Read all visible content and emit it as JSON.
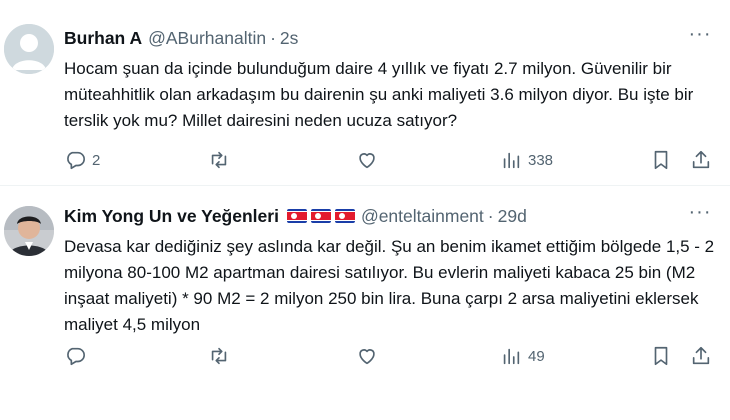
{
  "tweets": [
    {
      "display_name": "Burhan A",
      "handle": "@ABurhanaltin",
      "separator": "·",
      "time": "2s",
      "text": "Hocam şuan da içinde bulunduğum daire 4 yıllık ve fiyatı 2.7 milyon. Güvenilir bir müteahhitlik olan arkadaşım bu dairenin şu anki maliyeti 3.6 milyon diyor. Bu işte bir terslik yok mu? Millet dairesini neden ucuza satıyor?",
      "more_icon": "···",
      "replies": "2",
      "retweets": "",
      "likes": "",
      "views": "338",
      "avatar": "default-avatar"
    },
    {
      "display_name": "Kim Yong Un ve Yeğenleri",
      "flags": [
        "north-korea-flag",
        "north-korea-flag",
        "north-korea-flag"
      ],
      "handle": "@enteltainment",
      "separator": "·",
      "time": "29d",
      "text": "Devasa kar dediğiniz şey aslında kar değil. Şu an benim ikamet ettiğim bölgede 1,5 - 2 milyona 80-100 M2 apartman dairesi satılıyor. Bu evlerin maliyeti kabaca 25 bin (M2 inşaat maliyeti) * 90 M2 = 2 milyon 250 bin lira. Buna çarpı 2 arsa maliyetini eklersek maliyet 4,5 milyon",
      "more_icon": "···",
      "replies": "",
      "retweets": "",
      "likes": "",
      "views": "49",
      "avatar": "profile-photo"
    }
  ],
  "colors": {
    "text": "#0f1419",
    "secondary": "#536471",
    "divider": "#eff3f4",
    "flag_blue": "#1a3ea8",
    "flag_red": "#e31b2e"
  }
}
